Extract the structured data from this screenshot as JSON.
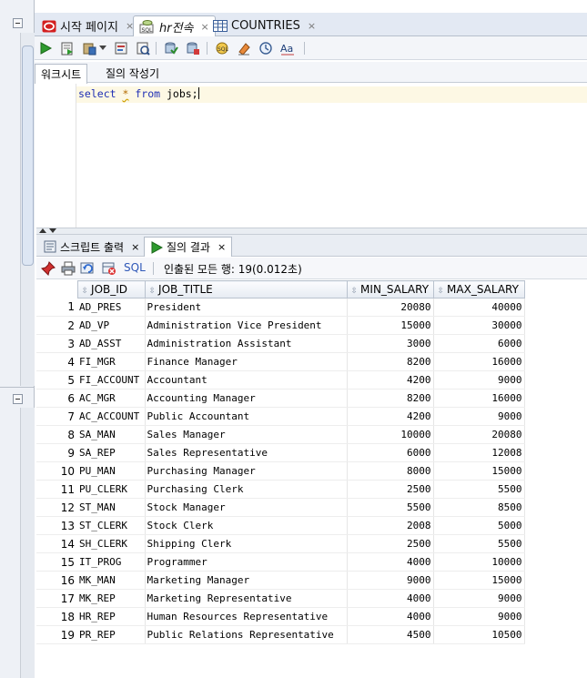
{
  "tabs": [
    {
      "label": "시작 페이지"
    },
    {
      "label": "hr전속"
    },
    {
      "label": "COUNTRIES"
    }
  ],
  "subtabs": {
    "worksheet": "워크시트",
    "query_builder": "질의 작성기"
  },
  "editor": {
    "kw_select": "select",
    "star": "*",
    "kw_from": "from",
    "rest": " jobs;"
  },
  "output_tabs": {
    "script_output": "스크립트 출력",
    "query_result": "질의 결과"
  },
  "result_toolbar": {
    "sql_label": "SQL",
    "fetch_status": "인출된 모든 행: 19(0.012초)"
  },
  "grid": {
    "columns": [
      "JOB_ID",
      "JOB_TITLE",
      "MIN_SALARY",
      "MAX_SALARY"
    ],
    "rows": [
      [
        "1",
        "AD_PRES",
        "President",
        "20080",
        "40000"
      ],
      [
        "2",
        "AD_VP",
        "Administration Vice President",
        "15000",
        "30000"
      ],
      [
        "3",
        "AD_ASST",
        "Administration Assistant",
        "3000",
        "6000"
      ],
      [
        "4",
        "FI_MGR",
        "Finance Manager",
        "8200",
        "16000"
      ],
      [
        "5",
        "FI_ACCOUNT",
        "Accountant",
        "4200",
        "9000"
      ],
      [
        "6",
        "AC_MGR",
        "Accounting Manager",
        "8200",
        "16000"
      ],
      [
        "7",
        "AC_ACCOUNT",
        "Public Accountant",
        "4200",
        "9000"
      ],
      [
        "8",
        "SA_MAN",
        "Sales Manager",
        "10000",
        "20080"
      ],
      [
        "9",
        "SA_REP",
        "Sales Representative",
        "6000",
        "12008"
      ],
      [
        "10",
        "PU_MAN",
        "Purchasing Manager",
        "8000",
        "15000"
      ],
      [
        "11",
        "PU_CLERK",
        "Purchasing Clerk",
        "2500",
        "5500"
      ],
      [
        "12",
        "ST_MAN",
        "Stock Manager",
        "5500",
        "8500"
      ],
      [
        "13",
        "ST_CLERK",
        "Stock Clerk",
        "2008",
        "5000"
      ],
      [
        "14",
        "SH_CLERK",
        "Shipping Clerk",
        "2500",
        "5500"
      ],
      [
        "15",
        "IT_PROG",
        "Programmer",
        "4000",
        "10000"
      ],
      [
        "16",
        "MK_MAN",
        "Marketing Manager",
        "9000",
        "15000"
      ],
      [
        "17",
        "MK_REP",
        "Marketing Representative",
        "4000",
        "9000"
      ],
      [
        "18",
        "HR_REP",
        "Human Resources Representative",
        "4000",
        "9000"
      ],
      [
        "19",
        "PR_REP",
        "Public Relations Representative",
        "4500",
        "10500"
      ]
    ]
  },
  "colors": {
    "keyword": "#1f2fb4",
    "current_line": "#fdf8e4",
    "play_green": "#2e9a2e"
  }
}
